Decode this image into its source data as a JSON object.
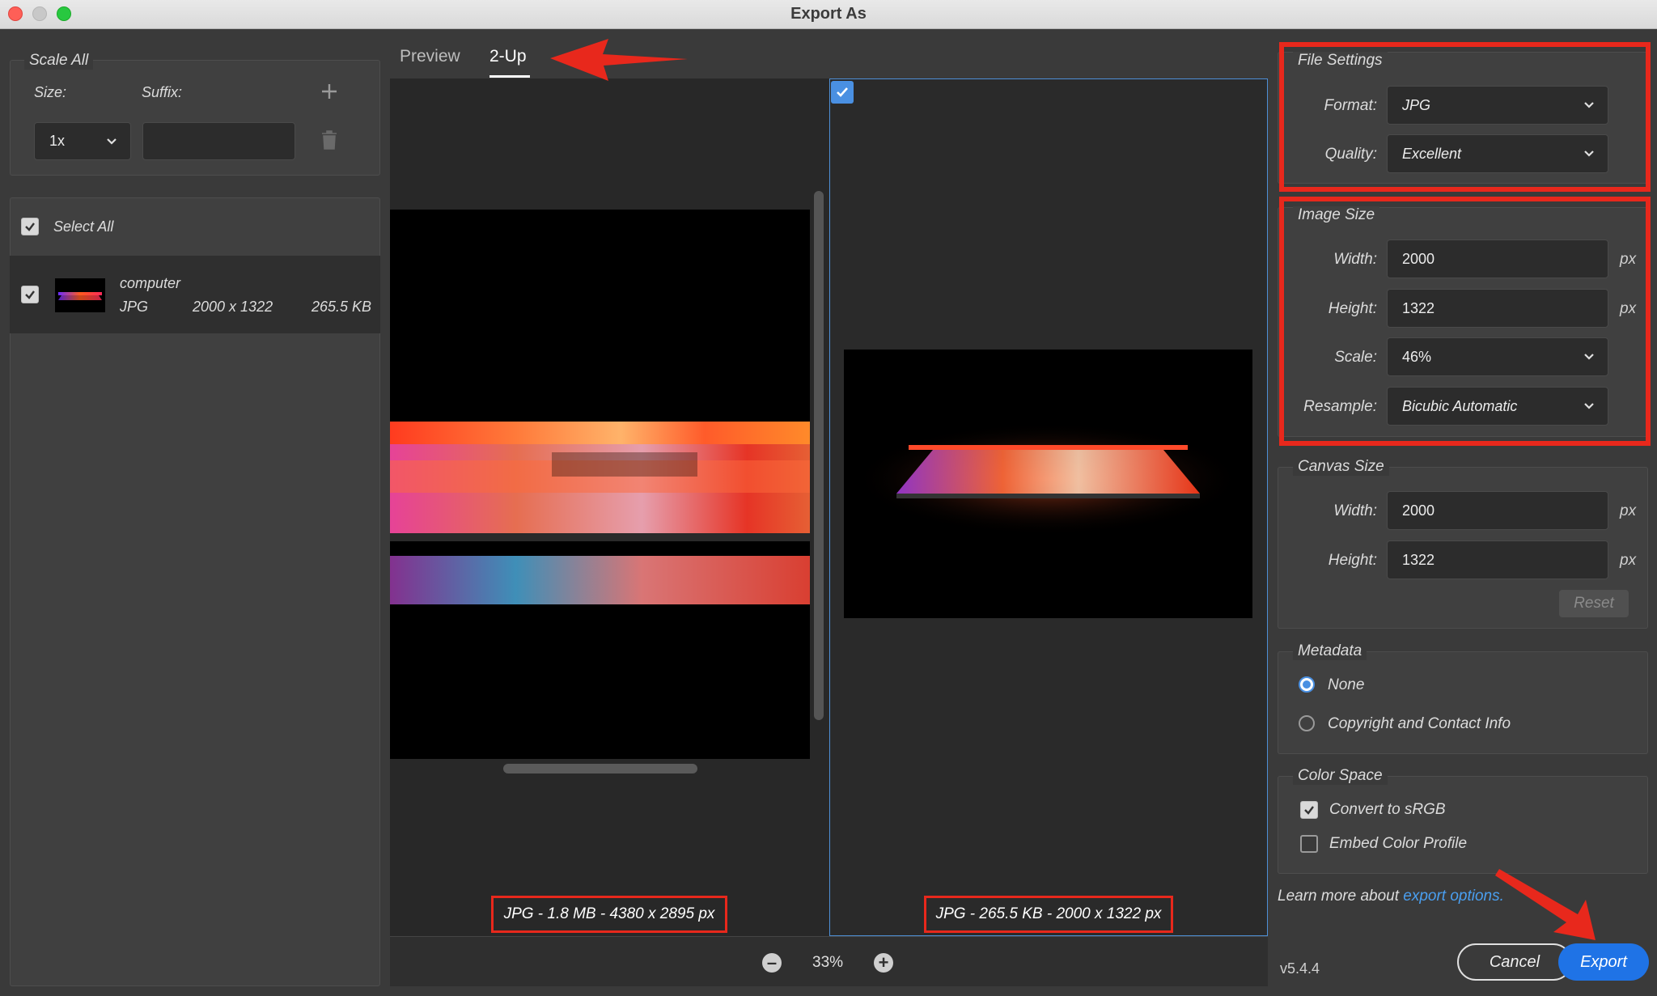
{
  "window": {
    "title": "Export As"
  },
  "scale_all": {
    "group_label": "Scale All",
    "size_label": "Size:",
    "suffix_label": "Suffix:",
    "size_value": "1x",
    "suffix_value": ""
  },
  "assets": {
    "select_all_label": "Select All",
    "select_all_checked": true,
    "items": [
      {
        "name": "computer",
        "format": "JPG",
        "dimensions": "2000 x 1322",
        "size": "265.5 KB",
        "checked": true
      }
    ]
  },
  "preview": {
    "tabs": [
      {
        "label": "Preview",
        "active": false
      },
      {
        "label": "2-Up",
        "active": true
      }
    ],
    "left_caption": "JPG - 1.8 MB - 4380 x 2895 px",
    "right_caption": "JPG - 265.5 KB - 2000 x 1322 px",
    "zoom": "33%"
  },
  "file_settings": {
    "group_label": "File Settings",
    "format_label": "Format:",
    "format_value": "JPG",
    "quality_label": "Quality:",
    "quality_value": "Excellent"
  },
  "image_size": {
    "group_label": "Image Size",
    "width_label": "Width:",
    "width_value": "2000",
    "height_label": "Height:",
    "height_value": "1322",
    "scale_label": "Scale:",
    "scale_value": "46%",
    "resample_label": "Resample:",
    "resample_value": "Bicubic Automatic",
    "unit": "px"
  },
  "canvas_size": {
    "group_label": "Canvas Size",
    "width_label": "Width:",
    "width_value": "2000",
    "height_label": "Height:",
    "height_value": "1322",
    "unit": "px",
    "reset_label": "Reset"
  },
  "metadata": {
    "group_label": "Metadata",
    "options": [
      {
        "label": "None",
        "selected": true
      },
      {
        "label": "Copyright and Contact Info",
        "selected": false
      }
    ]
  },
  "color_space": {
    "group_label": "Color Space",
    "convert_label": "Convert to sRGB",
    "convert_checked": true,
    "embed_label": "Embed Color Profile",
    "embed_checked": false
  },
  "footer": {
    "learn_more_text": "Learn more about ",
    "learn_more_link": "export options.",
    "version": "v5.4.4",
    "cancel_label": "Cancel",
    "export_label": "Export"
  },
  "colors": {
    "annotation_red": "#e8281c",
    "accent_blue": "#1f73e6"
  }
}
